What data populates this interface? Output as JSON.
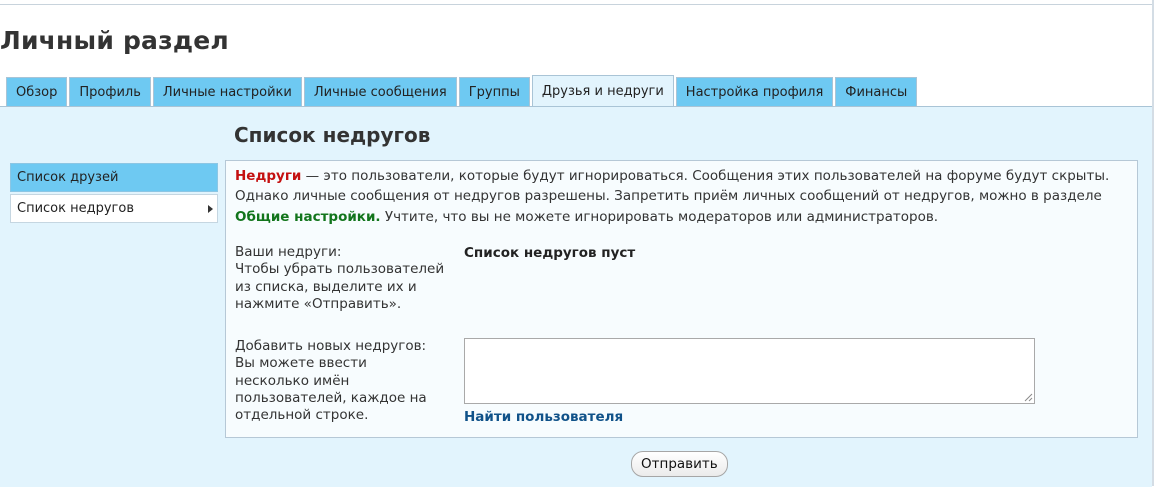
{
  "page": {
    "title": "Личный раздел"
  },
  "tabs": [
    {
      "label": "Обзор"
    },
    {
      "label": "Профиль"
    },
    {
      "label": "Личные настройки"
    },
    {
      "label": "Личные сообщения"
    },
    {
      "label": "Группы"
    },
    {
      "label": "Друзья и недруги",
      "active": true
    },
    {
      "label": "Настройка профиля"
    },
    {
      "label": "Финансы"
    }
  ],
  "sidebar": {
    "items": [
      {
        "label": "Список друзей"
      },
      {
        "label": "Список недругов",
        "current": true
      }
    ]
  },
  "section": {
    "title": "Список недругов",
    "intro_term": "Недруги",
    "intro_text": " — это пользователи, которые будут игнорироваться. Сообщения этих пользователей на форуме будут скрыты. Однако личные сообщения от недругов разрешены. Запретить приём личных сообщений от недругов, можно в разделе ",
    "intro_link": "Общие настройки.",
    "intro_tail": " Учтите, что вы не можете игнорировать модераторов или администраторов."
  },
  "foes": {
    "label": "Ваши недруги:",
    "hint": "Чтобы убрать пользователей из списка, выделите их и нажмите «Отправить».",
    "empty_message": "Список недругов пуст"
  },
  "add_foes": {
    "label": "Добавить новых недругов:",
    "hint": "Вы можете ввести несколько имён пользователей, каждое на отдельной строке.",
    "input_value": "",
    "find_link": "Найти пользователя"
  },
  "form": {
    "submit_label": "Отправить"
  },
  "colors": {
    "tab_bg": "#6ec9f2",
    "panel_bg": "#e2f4fd",
    "term_red": "#c41010",
    "link_green": "#12751c",
    "link_blue": "#105289"
  }
}
